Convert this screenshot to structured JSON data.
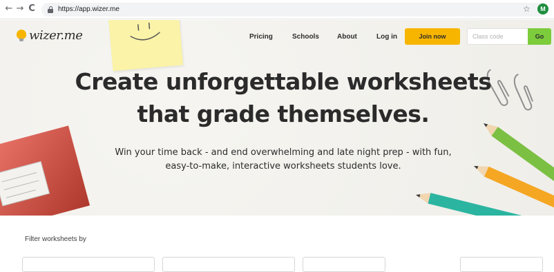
{
  "browser": {
    "back_icon": "←",
    "forward_icon": "→",
    "reload_icon": "C",
    "url": "https://app.wizer.me",
    "bookmark_icon": "☆",
    "profile_initial": "M"
  },
  "header": {
    "logo_text": "wizer.me",
    "nav": [
      "Pricing",
      "Schools",
      "About",
      "Log in"
    ],
    "join_label": "Join now",
    "class_code_placeholder": "Class code",
    "go_label": "Go"
  },
  "hero": {
    "headline_line1": "Create unforgettable worksheets",
    "headline_line2": "that grade themselves.",
    "subline_line1": "Win your time back - and end overwhelming and late night prep - with fun,",
    "subline_line2": "easy-to-make, interactive worksheets students love."
  },
  "filter": {
    "title": "Filter worksheets by"
  },
  "colors": {
    "accent_yellow": "#f7b500",
    "go_green": "#7ccc3c",
    "hero_bg": "#f3f2ee",
    "text_dark": "#2b2b2b"
  }
}
